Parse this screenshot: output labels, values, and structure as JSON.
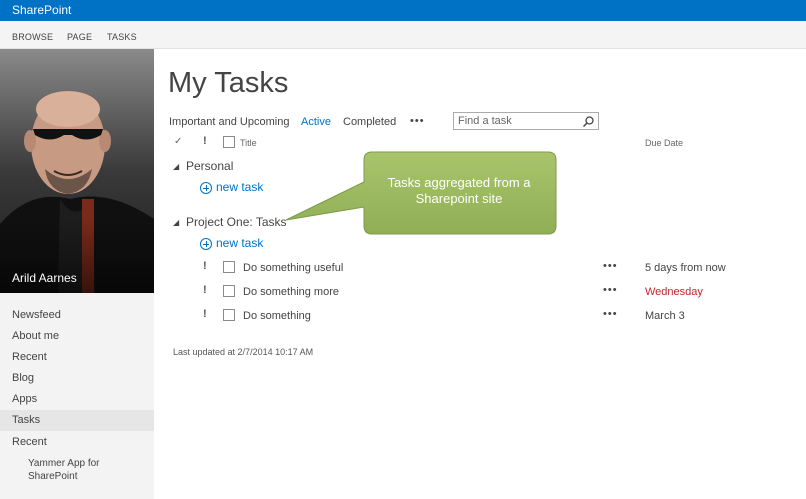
{
  "suite": {
    "brand": "SharePoint"
  },
  "ribbon": {
    "tabs": [
      "BROWSE",
      "PAGE",
      "TASKS"
    ]
  },
  "profile": {
    "name": "Arild Aarnes"
  },
  "nav": {
    "items": [
      "Newsfeed",
      "About me",
      "Recent",
      "Blog",
      "Apps",
      "Tasks",
      "Recent"
    ],
    "selected": "Tasks",
    "subitem": "Yammer App for SharePoint"
  },
  "page": {
    "title": "My Tasks"
  },
  "filters": {
    "items": [
      "Important and Upcoming",
      "Active",
      "Completed"
    ],
    "active": "Active",
    "more": "•••"
  },
  "search": {
    "placeholder": "Find a task"
  },
  "columns": {
    "check": "✓",
    "important": "!",
    "title": "Title",
    "due_date": "Due Date"
  },
  "groups": [
    {
      "label": "Personal",
      "new_task": "new task",
      "tasks": []
    },
    {
      "label": "Project One: Tasks",
      "new_task": "new task",
      "tasks": [
        {
          "title": "Do something useful",
          "due": "5 days from now"
        },
        {
          "title": "Do something more",
          "due": "Wednesday"
        },
        {
          "title": "Do something",
          "due": "March 3"
        }
      ]
    }
  ],
  "task_more": "•••",
  "last_updated": "Last updated at 2/7/2014 10:17 AM",
  "callout": {
    "text": "Tasks aggregated from a Sharepoint site"
  },
  "colors": {
    "accent": "#0072c6",
    "overdue": "#c1272d",
    "callout_fill": "#9dbb61"
  }
}
